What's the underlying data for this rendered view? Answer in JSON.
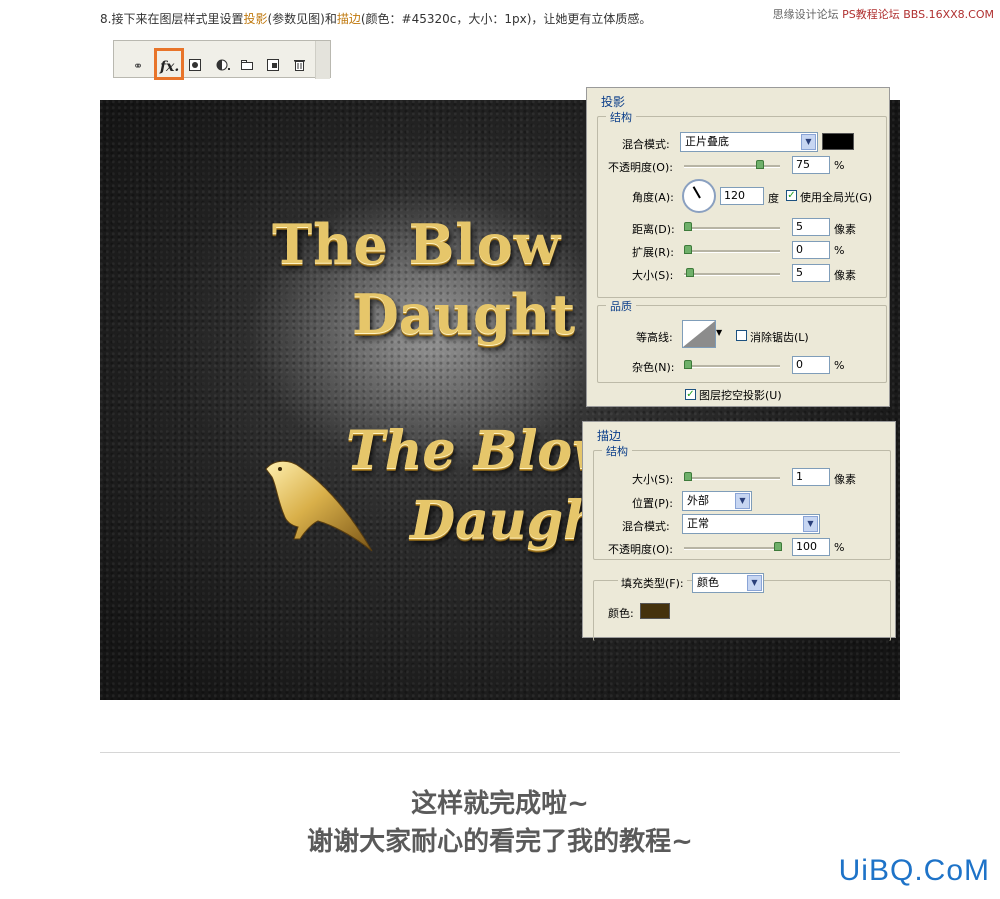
{
  "header": {
    "step_prefix": "8.接下来在图层样式里设置",
    "shadow_word": "投影",
    "mid": "(参数见图)和",
    "stroke_word": "描边",
    "suffix": "(颜色：#45320c，大小：1px)，让她更有立体质感。",
    "watermark_left": "思缘设计论坛",
    "watermark_right": "PS教程论坛 BBS.16XX8.COM"
  },
  "toolbar": {
    "icons": [
      "link-icon",
      "fx-icon",
      "mask-icon",
      "adjustment-icon",
      "group-folder-icon",
      "new-layer-icon",
      "trash-icon"
    ],
    "fx_label": "fx."
  },
  "artwork": {
    "line1": "The Blow",
    "line2": "Daught",
    "line3": "The Blow",
    "line4": "Daugh"
  },
  "drop_shadow": {
    "title": "投影",
    "structure_title": "结构",
    "blend_mode_label": "混合模式:",
    "blend_mode_value": "正片叠底",
    "blend_color": "#000000",
    "opacity_label": "不透明度(O):",
    "opacity_value": "75",
    "percent": "%",
    "angle_label": "角度(A):",
    "angle_value": "120",
    "degree": "度",
    "global_light_label": "使用全局光(G)",
    "distance_label": "距离(D):",
    "distance_value": "5",
    "px": "像素",
    "spread_label": "扩展(R):",
    "spread_value": "0",
    "size_label": "大小(S):",
    "size_value": "5",
    "quality_title": "品质",
    "contour_label": "等高线:",
    "antialias_label": "消除锯齿(L)",
    "noise_label": "杂色(N):",
    "noise_value": "0",
    "knockout_label": "图层挖空投影(U)"
  },
  "stroke": {
    "title": "描边",
    "structure_title": "结构",
    "size_label": "大小(S):",
    "size_value": "1",
    "px": "像素",
    "position_label": "位置(P):",
    "position_value": "外部",
    "blend_mode_label": "混合模式:",
    "blend_mode_value": "正常",
    "opacity_label": "不透明度(O):",
    "opacity_value": "100",
    "percent": "%",
    "fill_type_label": "填充类型(F):",
    "fill_type_value": "颜色",
    "color_label": "颜色:",
    "color": "#45320c"
  },
  "footer": {
    "line1": "这样就完成啦~",
    "line2": "谢谢大家耐心的看完了我的教程~",
    "brand": "UiBQ.CoM"
  }
}
